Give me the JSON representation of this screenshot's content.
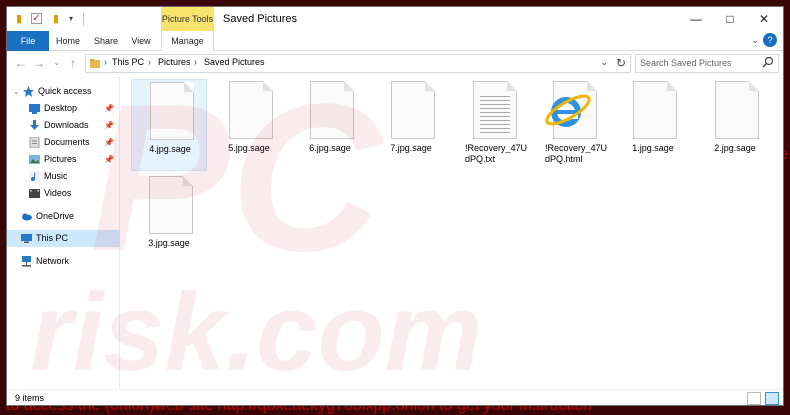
{
  "background_text": "to access the (onion)web site http://qbxeaekyg7o3ixpp.onion to get your instruction",
  "background_side_text": "le",
  "titlebar": {
    "context_tab": "Picture Tools",
    "title": "Saved Pictures"
  },
  "ribbon": {
    "tabs": [
      "File",
      "Home",
      "Share",
      "View",
      "Manage"
    ]
  },
  "address": {
    "crumbs": [
      "This PC",
      "Pictures",
      "Saved Pictures"
    ],
    "search_placeholder": "Search Saved Pictures"
  },
  "navpane": {
    "quick_access": "Quick access",
    "pinned": [
      "Desktop",
      "Downloads",
      "Documents",
      "Pictures"
    ],
    "others": [
      "Music",
      "Videos"
    ],
    "onedrive": "OneDrive",
    "this_pc": "This PC",
    "network": "Network"
  },
  "files": [
    {
      "name": "4.jpg.sage",
      "type": "blank"
    },
    {
      "name": "5.jpg.sage",
      "type": "blank"
    },
    {
      "name": "6.jpg.sage",
      "type": "blank"
    },
    {
      "name": "7.jpg.sage",
      "type": "blank"
    },
    {
      "name": "!Recovery_47UdPQ.txt",
      "type": "text"
    },
    {
      "name": "!Recovery_47UdPQ.html",
      "type": "html"
    },
    {
      "name": "1.jpg.sage",
      "type": "blank"
    },
    {
      "name": "2.jpg.sage",
      "type": "blank"
    },
    {
      "name": "3.jpg.sage",
      "type": "blank"
    }
  ],
  "status": {
    "count": "9 items"
  },
  "colors": {
    "accent": "#1a6fc1",
    "context_tab": "#f7e36d",
    "selection": "#cce8ff",
    "ransom_text": "#c00000"
  }
}
